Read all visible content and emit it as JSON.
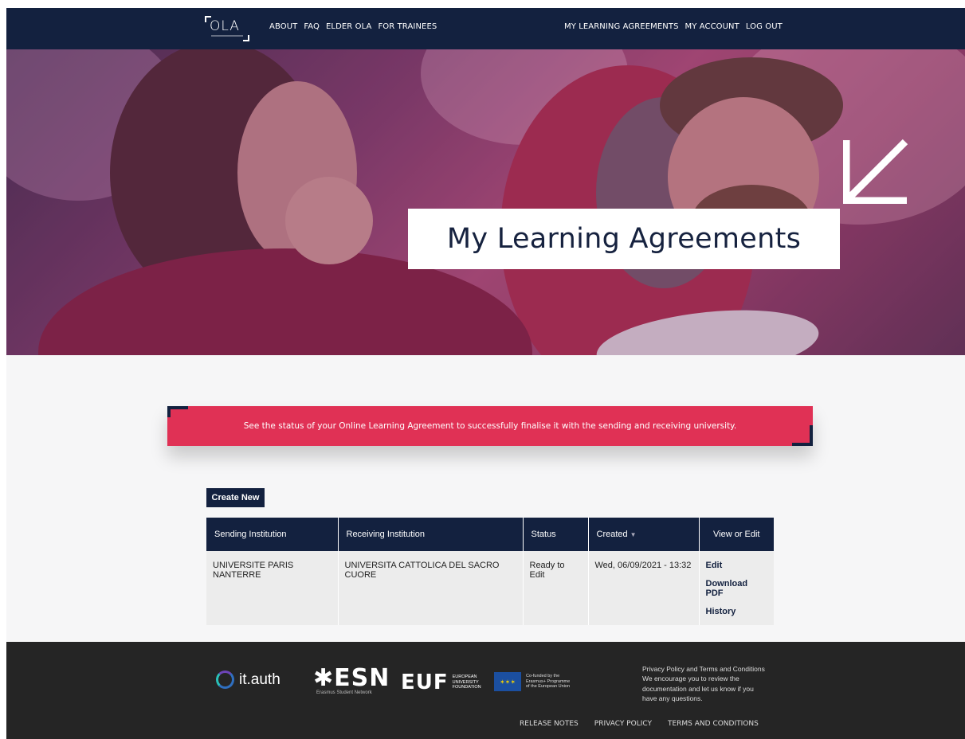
{
  "nav": {
    "logo": "OLA",
    "left_links": [
      "ABOUT",
      "FAQ",
      "ELDER OLA",
      "FOR TRAINEES"
    ],
    "right_links": [
      "MY LEARNING AGREEMENTS",
      "MY ACCOUNT",
      "LOG OUT"
    ]
  },
  "hero": {
    "title": "My Learning Agreements",
    "arrow_icon": "arrow-down-left-icon"
  },
  "banner": {
    "text": "See the status of your Online Learning Agreement to successfully finalise it with the sending and receiving university."
  },
  "actions": {
    "create_label": "Create New"
  },
  "table": {
    "columns": [
      "Sending Institution",
      "Receiving Institution",
      "Status",
      "Created",
      "View or Edit"
    ],
    "sort_icon": "sort-down-icon",
    "rows": [
      {
        "sending": "UNIVERSITE PARIS NANTERRE",
        "receiving": "UNIVERSITA CATTOLICA DEL SACRO CUORE",
        "status": "Ready to Edit",
        "created": "Wed, 06/09/2021 - 13:32",
        "links": [
          "Edit",
          "Download PDF",
          "History"
        ]
      }
    ]
  },
  "footer": {
    "logos": {
      "itauth": "it.auth",
      "esn": "ESN",
      "esn_sub": "Erasmus Student Network",
      "euf": "EUF",
      "euf_sub": [
        "EUROPEAN",
        "UNIVERSITY",
        "FOUNDATION"
      ],
      "eu_sub": [
        "Co-funded by the",
        "Erasmus+ Programme",
        "of the European Union"
      ]
    },
    "text": [
      "Privacy Policy and Terms and Conditions",
      "We encourage you to review the",
      "documentation and let us know if you",
      "have any questions."
    ],
    "links": [
      "RELEASE NOTES",
      "PRIVACY POLICY",
      "TERMS AND CONDITIONS"
    ]
  },
  "colors": {
    "navy": "#13213f",
    "accent_pink": "#e03155",
    "footer_bg": "#252525"
  }
}
